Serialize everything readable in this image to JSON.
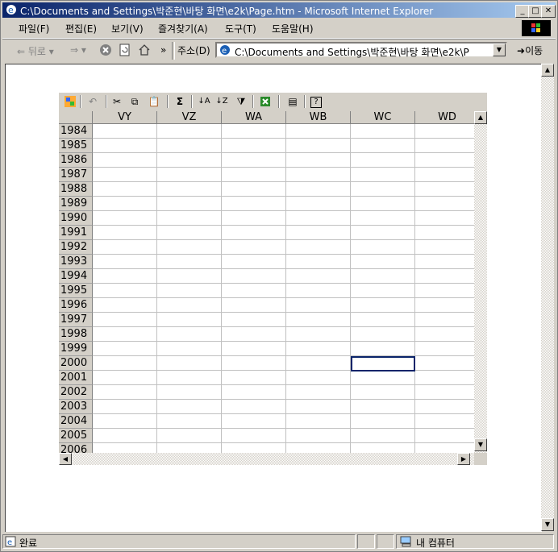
{
  "window": {
    "title": "C:\\Documents and Settings\\박준현\\바탕 화면\\e2k\\Page.htm - Microsoft Internet Explorer"
  },
  "menu": [
    "파일(F)",
    "편집(E)",
    "보기(V)",
    "즐겨찾기(A)",
    "도구(T)",
    "도움말(H)"
  ],
  "toolbar": {
    "back_label": "뒤로",
    "address_label": "주소(D)",
    "address_value": "C:\\Documents and Settings\\박준현\\바탕 화면\\e2k\\P",
    "go_label": "이동"
  },
  "spreadsheet": {
    "columns": [
      "VY",
      "VZ",
      "WA",
      "WB",
      "WC",
      "WD"
    ],
    "rows": [
      "1984",
      "1985",
      "1986",
      "1987",
      "1988",
      "1989",
      "1990",
      "1991",
      "1992",
      "1993",
      "1994",
      "1995",
      "1996",
      "1997",
      "1998",
      "1999",
      "2000",
      "2001",
      "2002",
      "2003",
      "2004",
      "2005",
      "2006"
    ],
    "selected": {
      "column": "WC",
      "row": "2000"
    },
    "tools": [
      "office-logo-icon",
      "undo-icon",
      "cut-icon",
      "copy-icon",
      "paste-icon",
      "autosum-icon",
      "sort-ascending-icon",
      "sort-descending-icon",
      "autofilter-icon",
      "export-to-excel-icon",
      "properties-icon",
      "help-icon"
    ]
  },
  "status": {
    "text": "완료",
    "zone": "내 컴퓨터"
  }
}
